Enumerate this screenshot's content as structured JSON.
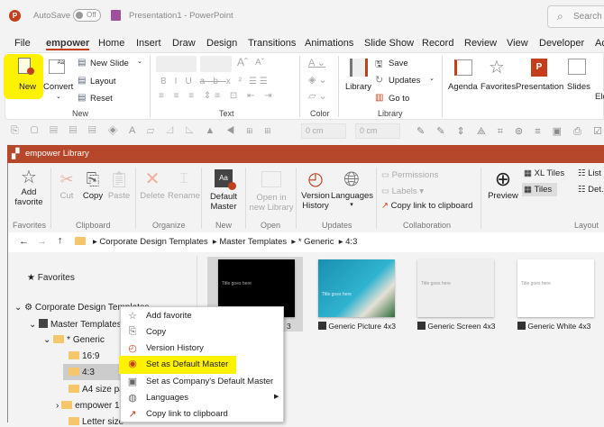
{
  "titlebar": {
    "autosave_label": "AutoSave",
    "toggle_state": "Off",
    "doc_title": "Presentation1 - PowerPoint",
    "search_placeholder": "Search"
  },
  "menu": [
    "File",
    "empower",
    "Home",
    "Insert",
    "Draw",
    "Design",
    "Transitions",
    "Animations",
    "Slide Show",
    "Record",
    "Review",
    "View",
    "Developer",
    "Ac"
  ],
  "ribbon": {
    "new_group": {
      "new": "New",
      "convert": "Convert",
      "new_slide": "New Slide",
      "layout": "Layout",
      "reset": "Reset",
      "label": "New"
    },
    "text_label": "Text",
    "color_label": "Color",
    "library_group": {
      "library": "Library",
      "save": "Save",
      "updates": "Updates",
      "goto": "Go to",
      "label": "Library"
    },
    "right": {
      "agenda": "Agenda",
      "favorites": "Favorites",
      "presentation": "Presentation",
      "slides": "Slides",
      "ele": "Ele"
    }
  },
  "toolbar": {
    "width_value": "0 cm",
    "height_value": "0 cm"
  },
  "library": {
    "title": "empower Library",
    "buttons": {
      "add_favorite": "Add favorite",
      "cut": "Cut",
      "copy": "Copy",
      "paste": "Paste",
      "delete": "Delete",
      "rename": "Rename",
      "default_master": "Default Master",
      "open_new": "Open in new Library",
      "version_history": "Version History",
      "languages": "Languages",
      "permissions": "Permissions",
      "labels": "Labels",
      "copy_link": "Copy link to clipboard",
      "preview": "Preview",
      "xl_tiles": "XL Tiles",
      "tiles": "Tiles",
      "list": "List",
      "details": "Det."
    },
    "groups": [
      "Favorites",
      "Clipboard",
      "Organize",
      "New",
      "Open",
      "Updates",
      "Collaboration",
      "Layout"
    ],
    "breadcrumb": [
      "Corporate Design Templates",
      "Master Templates",
      "* Generic",
      "4:3"
    ],
    "tree": {
      "favorites": "Favorites",
      "corporate": "Corporate Design Templates",
      "master": "Master Templates",
      "generic": "* Generic",
      "f169": "16:9",
      "f43": "4:3",
      "a4": "A4 size paper",
      "empower": "empower 1",
      "letter": "Letter size"
    },
    "tiles": [
      {
        "name": "Generic Dark 4x3",
        "partial": "3"
      },
      {
        "name": "Generic Picture 4x3"
      },
      {
        "name": "Generic Screen 4x3"
      },
      {
        "name": "Generic White 4x3"
      }
    ],
    "thumb_title": "Title goes here"
  },
  "context_menu": [
    "Add favorite",
    "Copy",
    "Version History",
    "Set as Default Master",
    "Set as Company's Default Master",
    "Languages",
    "Copy link to clipboard"
  ],
  "colors": {
    "accent": "#b7472a",
    "highlight": "#fff200"
  }
}
